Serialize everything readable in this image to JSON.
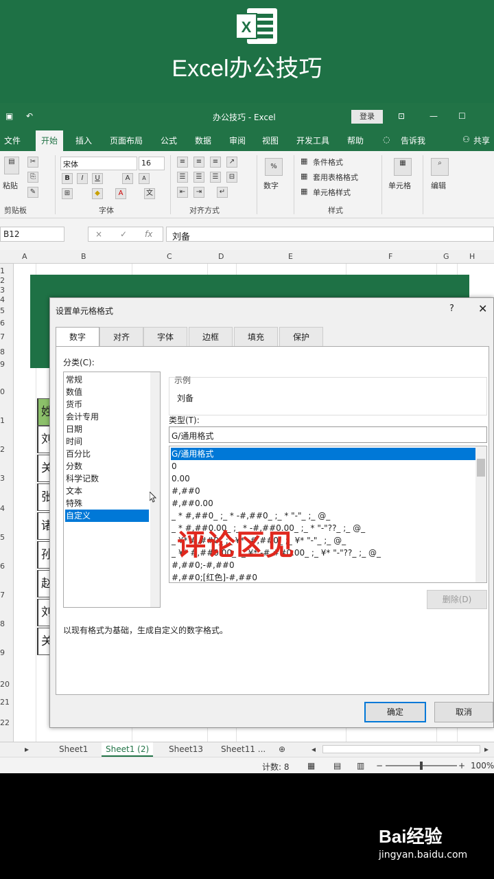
{
  "banner": {
    "title": "Excel办公技巧",
    "logo_letter": "X"
  },
  "titlebar": {
    "save_icon": "save-icon",
    "undo": "↶",
    "doc_title": "办公技巧 - Excel",
    "login": "登录"
  },
  "tabs": [
    "文件",
    "开始",
    "插入",
    "页面布局",
    "公式",
    "数据",
    "审阅",
    "视图",
    "开发工具",
    "帮助",
    "告诉我",
    "共享"
  ],
  "ribbon": {
    "paste": "粘贴",
    "clipboard": "剪贴板",
    "font_name": "宋体",
    "font_size": "16",
    "font_group": "字体",
    "align_group": "对齐方式",
    "number_label": "数字",
    "number_symbol": "%",
    "conditional": "条件格式",
    "table_format": "套用表格格式",
    "cell_style": "单元格样式",
    "style_group": "样式",
    "cells": "单元格",
    "edit": "编辑",
    "bold": "B",
    "italic": "I",
    "underline": "U",
    "font_up": "A",
    "font_down": "A",
    "wen": "文"
  },
  "formula_bar": {
    "cell_ref": "B12",
    "value": "刘备",
    "cancel": "×",
    "enter": "✓",
    "fx": "fx"
  },
  "columns": [
    "A",
    "B",
    "C",
    "D",
    "E",
    "F",
    "G",
    "H"
  ],
  "rows": [
    "1",
    "2",
    "3",
    "4",
    "5",
    "6",
    "7",
    "8",
    "9",
    "0",
    "1",
    "2",
    "3",
    "4",
    "5",
    "6",
    "7",
    "8",
    "9",
    "20",
    "21",
    "22"
  ],
  "name_cells": [
    "姓",
    "刘",
    "关",
    "张",
    "诸",
    "孙",
    "赵",
    "刘",
    "关"
  ],
  "dialog": {
    "title": "设置单元格格式",
    "help": "?",
    "close": "✕",
    "tabs": [
      "数字",
      "对齐",
      "字体",
      "边框",
      "填充",
      "保护"
    ],
    "category_label": "分类(C):",
    "categories": [
      "常规",
      "数值",
      "货币",
      "会计专用",
      "日期",
      "时间",
      "百分比",
      "分数",
      "科学记数",
      "文本",
      "特殊",
      "自定义"
    ],
    "selected_category": "自定义",
    "sample_label": "示例",
    "sample_value": "刘备",
    "type_label": "类型(T):",
    "type_value": "G/通用格式",
    "formats": [
      "G/通用格式",
      "0",
      "0.00",
      "#,##0",
      "#,##0.00",
      "_ * #,##0_ ;_ * -#,##0_ ;_ * \"-\"_ ;_ @_",
      "_ * #,##0.00_ ;_ * -#,##0.00_ ;_ * \"-\"??_ ;_ @_",
      "_ ¥* #,##0_ ;_ ¥* -#,##0_ ;_ ¥* \"-\"_ ;_ @_",
      "_ ¥* #,##0.00_ ;_ ¥* -#,##0.00_ ;_ ¥* \"-\"??_ ;_ @_",
      "#,##0;-#,##0",
      "#,##0;[红色]-#,##0"
    ],
    "delete": "删除(D)",
    "description": "以现有格式为基础，生成自定义的数字格式。",
    "ok": "确定",
    "cancel": "取消"
  },
  "overlay_text": "评论区见",
  "sheet_tabs": [
    "Sheet1",
    "Sheet1 (2)",
    "Sheet13",
    "Sheet11 ..."
  ],
  "status": {
    "count": "计数: 8",
    "zoom": "100%"
  },
  "watermark": {
    "logo": "Bai经验",
    "url": "jingyan.baidu.com"
  }
}
